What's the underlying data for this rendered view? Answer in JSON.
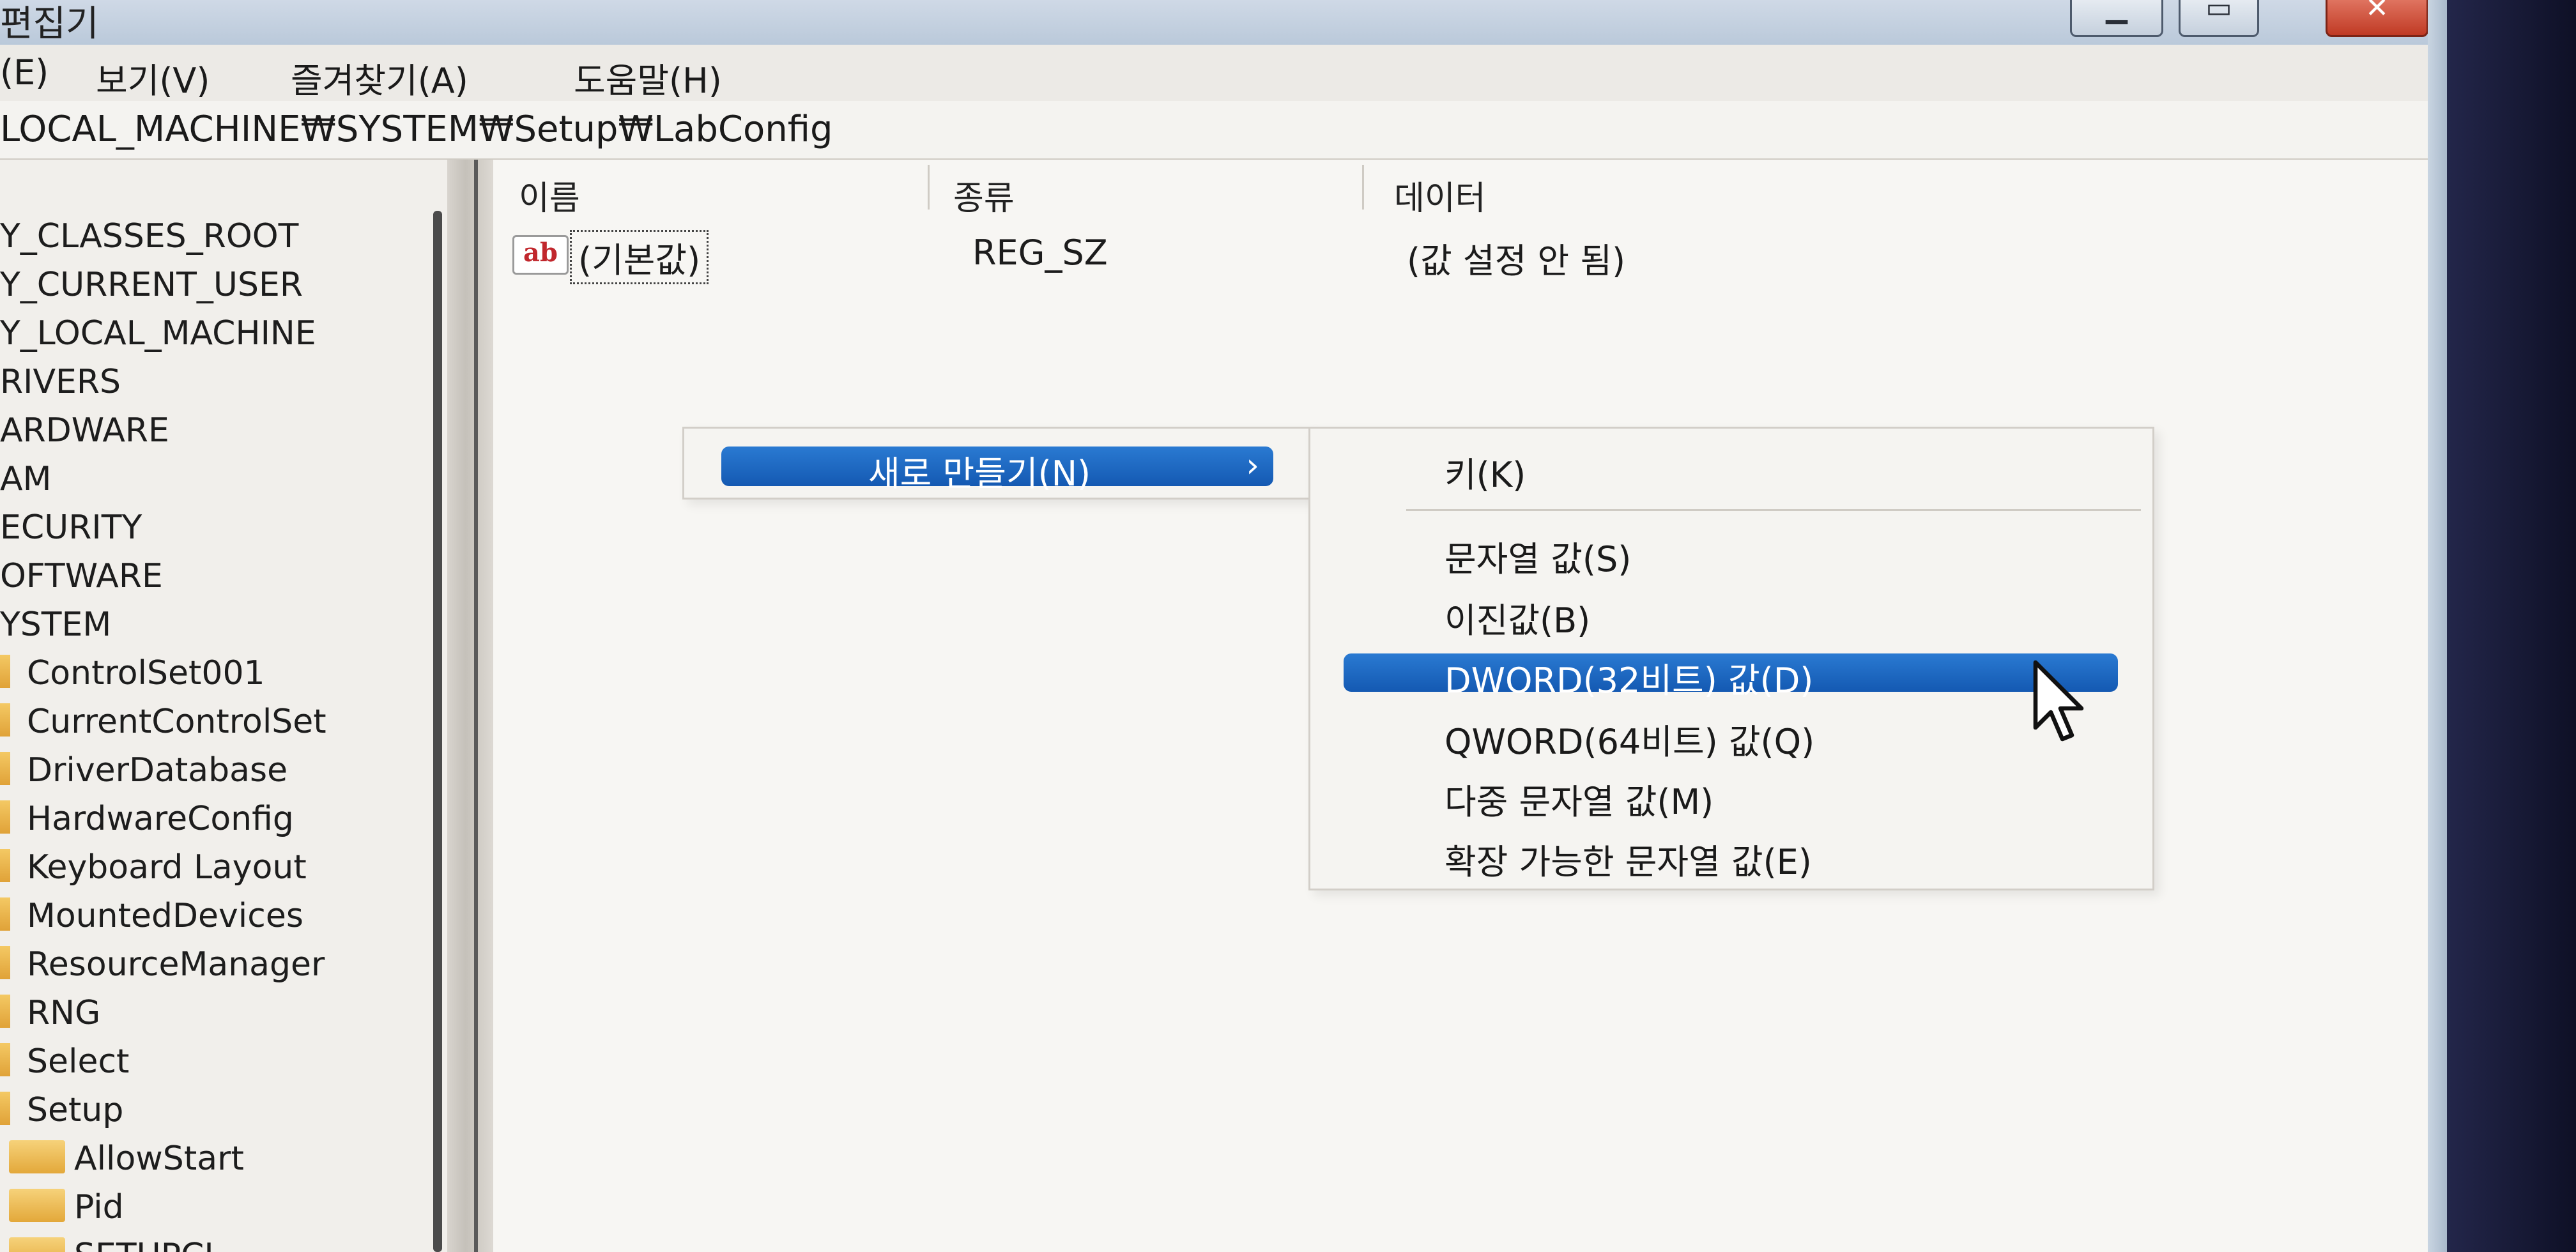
{
  "window": {
    "title": "편집기"
  },
  "titlebar_buttons": {
    "minimize": "▁",
    "maximize": "▭",
    "close": "✕"
  },
  "menubar": [
    "(E)",
    "보기(V)",
    "즐겨찾기(A)",
    "도움말(H)"
  ],
  "address": "LOCAL_MACHINE₩SYSTEM₩Setup₩LabConfig",
  "tree": {
    "roots": [
      "Y_CLASSES_ROOT",
      "Y_CURRENT_USER",
      "Y_LOCAL_MACHINE"
    ],
    "hklm_children": [
      "RIVERS",
      "ARDWARE",
      "AM",
      "ECURITY",
      "OFTWARE",
      "YSTEM"
    ],
    "system_children": [
      "ControlSet001",
      "CurrentControlSet",
      "DriverDatabase",
      "HardwareConfig",
      "Keyboard Layout",
      "MountedDevices",
      "ResourceManager",
      "RNG",
      "Select",
      "Setup"
    ],
    "setup_children": [
      "AllowStart",
      "Pid",
      "SETUPCI"
    ]
  },
  "values_pane": {
    "columns": [
      "이름",
      "종류",
      "데이터"
    ],
    "rows": [
      {
        "icon": "ab",
        "name": "(기본값)",
        "type": "REG_SZ",
        "data": "(값 설정 안 됨)"
      }
    ]
  },
  "context_menu": {
    "new_label": "새로 만들기(N)",
    "arrow": "›"
  },
  "submenu": {
    "items": [
      "키(K)",
      "문자열 값(S)",
      "이진값(B)",
      "DWORD(32비트) 값(D)",
      "QWORD(64비트) 값(Q)",
      "다중 문자열 값(M)",
      "확장 가능한 문자열 값(E)"
    ],
    "highlighted_index": 3
  },
  "colors": {
    "highlight": "#1f6cc4",
    "folder": "#e9b44c"
  }
}
